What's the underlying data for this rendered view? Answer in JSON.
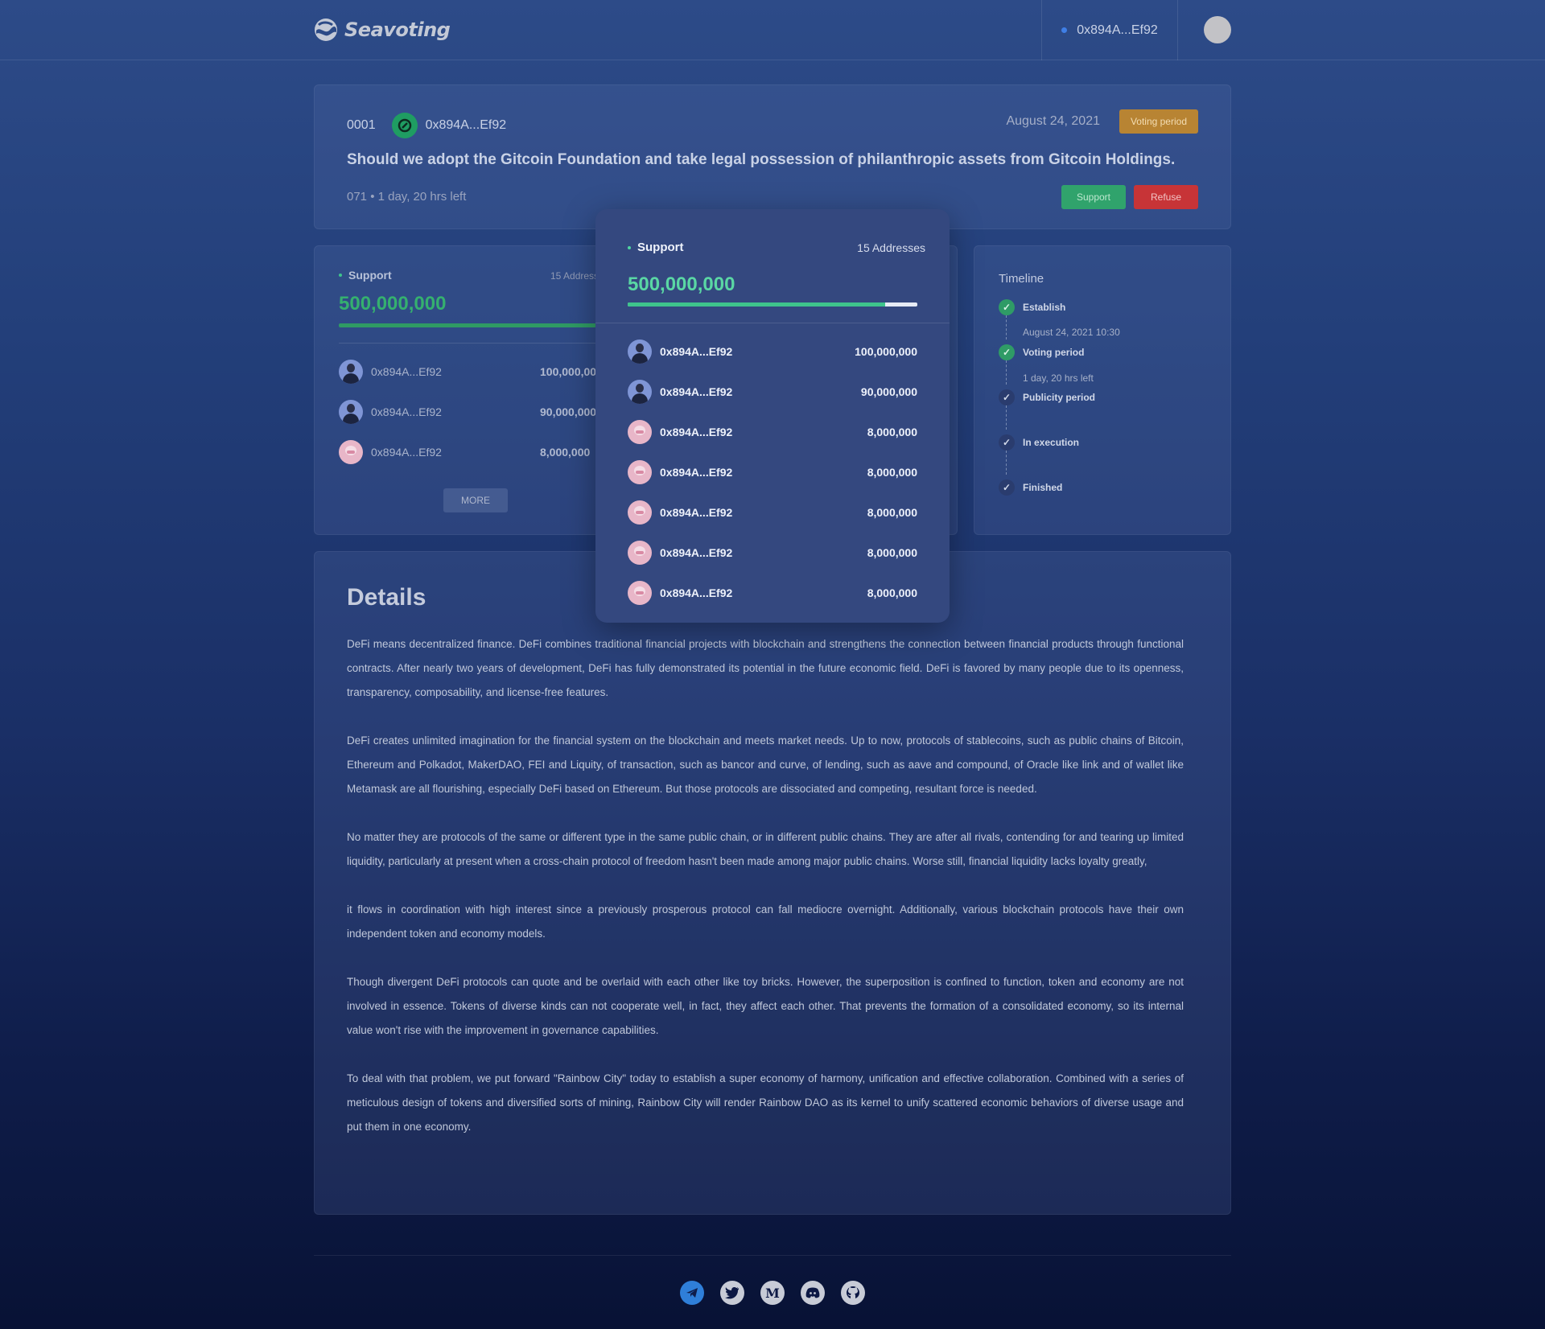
{
  "header": {
    "brand": "Seavoting",
    "wallet_address": "0x894A...Ef92"
  },
  "proposal": {
    "id": "0001",
    "author": "0x894A...Ef92",
    "date": "August 24, 2021",
    "status": "Voting period",
    "title": "Should we adopt the Gitcoin Foundation and take legal possession of philanthropic assets from Gitcoin Holdings.",
    "meta": "071 • 1 day, 20 hrs left",
    "support_label": "Support",
    "refuse_label": "Refuse"
  },
  "support_card": {
    "label": "Support",
    "count": "15 Addresses",
    "total": "500,000,000",
    "more_label": "MORE",
    "rows": [
      {
        "address": "0x894A...Ef92",
        "amount": "100,000,000",
        "avatar": "man"
      },
      {
        "address": "0x894A...Ef92",
        "amount": "90,000,000",
        "avatar": "man"
      },
      {
        "address": "0x894A...Ef92",
        "amount": "8,000,000",
        "avatar": "pink"
      }
    ]
  },
  "support_popup": {
    "label": "Support",
    "count": "15 Addresses",
    "total": "500,000,000",
    "progress": 0.89,
    "rows": [
      {
        "address": "0x894A...Ef92",
        "amount": "100,000,000",
        "avatar": "man"
      },
      {
        "address": "0x894A...Ef92",
        "amount": "90,000,000",
        "avatar": "man"
      },
      {
        "address": "0x894A...Ef92",
        "amount": "8,000,000",
        "avatar": "pink"
      },
      {
        "address": "0x894A...Ef92",
        "amount": "8,000,000",
        "avatar": "pink"
      },
      {
        "address": "0x894A...Ef92",
        "amount": "8,000,000",
        "avatar": "pink"
      },
      {
        "address": "0x894A...Ef92",
        "amount": "8,000,000",
        "avatar": "pink"
      },
      {
        "address": "0x894A...Ef92",
        "amount": "8,000,000",
        "avatar": "pink"
      }
    ]
  },
  "timeline": {
    "title": "Timeline",
    "steps": [
      {
        "label": "Establish",
        "sub": "August 24, 2021  10:30",
        "done": true
      },
      {
        "label": "Voting period",
        "sub": "1 day, 20 hrs left",
        "done": true
      },
      {
        "label": "Publicity period",
        "sub": "",
        "done": false
      },
      {
        "label": "In execution",
        "sub": "",
        "done": false
      },
      {
        "label": "Finished",
        "sub": "",
        "done": false
      }
    ]
  },
  "details": {
    "title": "Details",
    "paragraphs": [
      "DeFi means decentralized finance. DeFi combines traditional financial projects with blockchain and strengthens the connection between financial products through functional contracts. After nearly two years of development, DeFi has fully demonstrated its potential in the future economic field. DeFi is favored by many people due to its openness, transparency, composability, and license-free features.",
      "DeFi creates unlimited imagination for the financial system on the blockchain and meets market needs. Up to now, protocols of stablecoins, such as public chains of Bitcoin, Ethereum and Polkadot, MakerDAO, FEI and Liquity, of transaction, such as bancor and curve, of lending, such as aave and compound, of Oracle like link and of wallet like Metamask are all flourishing, especially DeFi based on Ethereum. But those protocols are dissociated and competing, resultant force is needed.",
      "No matter they are protocols of the same or different type in the same public chain, or in different public chains. They are after all rivals, contending for and tearing up limited liquidity, particularly at present when a cross-chain protocol of freedom hasn't been made among major public chains. Worse still, financial liquidity lacks loyalty greatly,",
      "it flows in coordination with high interest since a previously prosperous protocol can fall mediocre overnight. Additionally, various blockchain protocols have their own independent token and economy models.",
      "Though divergent DeFi protocols can quote and be overlaid with each other like toy bricks. However, the superposition is confined to function, token and economy are not involved in essence. Tokens of diverse kinds can not cooperate well, in fact, they affect each other. That prevents the formation of a consolidated economy, so its internal value won't rise with the improvement in governance capabilities.",
      "To deal with that problem, we put forward \"Rainbow City\" today to establish a super economy of harmony, unification and effective collaboration. Combined with a series of meticulous design of tokens and diversified sorts of mining, Rainbow City will render Rainbow DAO as its kernel to unify scattered economic behaviors of diverse usage and put them in one economy."
    ]
  },
  "footer": {
    "socials": [
      "telegram-icon",
      "twitter-icon",
      "medium-icon",
      "discord-icon",
      "github-icon"
    ],
    "medium_glyph": "M"
  },
  "colors": {
    "accent_green": "#3ec48c",
    "status_orange": "#b88433",
    "refuse_red": "#c73437"
  }
}
